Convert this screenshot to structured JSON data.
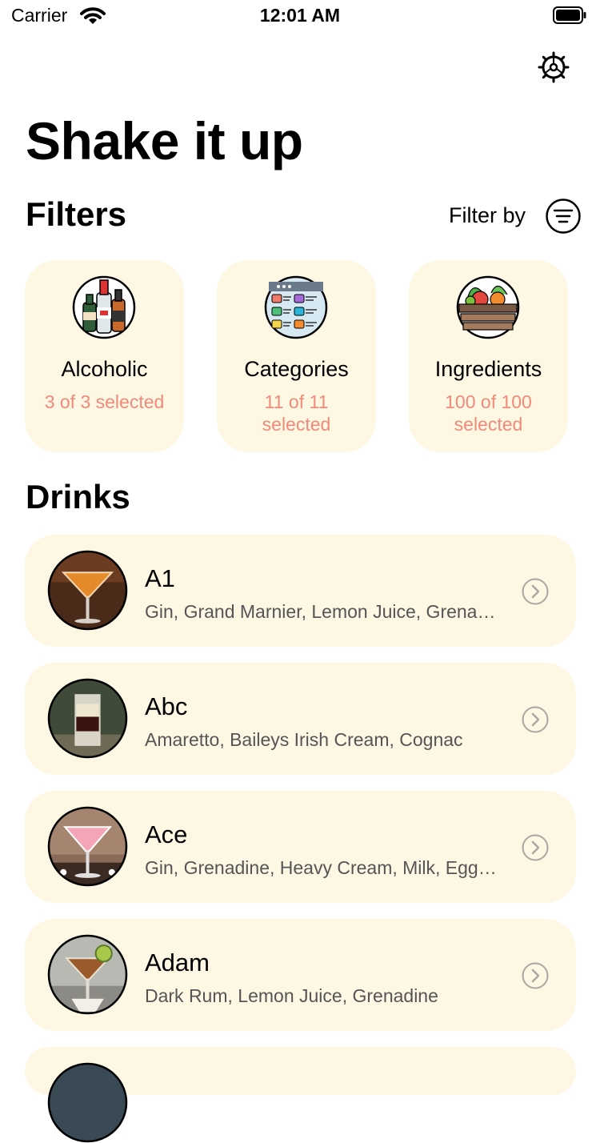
{
  "status_bar": {
    "carrier": "Carrier",
    "time": "12:01 AM"
  },
  "title": "Shake it up",
  "filters": {
    "title": "Filters",
    "filter_by_label": "Filter by",
    "cards": [
      {
        "label": "Alcoholic",
        "count": "3 of 3 selected",
        "icon": "bottles-icon"
      },
      {
        "label": "Categories",
        "count": "11 of 11 selected",
        "icon": "categories-icon"
      },
      {
        "label": "Ingredients",
        "count": "100 of 100 selected",
        "icon": "vegetable-crate-icon"
      }
    ]
  },
  "drinks": {
    "title": "Drinks",
    "items": [
      {
        "name": "A1",
        "ingredients": "Gin, Grand Marnier, Lemon Juice, Grenadine"
      },
      {
        "name": "Abc",
        "ingredients": "Amaretto, Baileys Irish Cream, Cognac"
      },
      {
        "name": "Ace",
        "ingredients": "Gin, Grenadine, Heavy Cream, Milk, Egg White"
      },
      {
        "name": "Adam",
        "ingredients": "Dark Rum, Lemon Juice, Grenadine"
      }
    ]
  },
  "colors": {
    "card_bg": "#fdf7e3",
    "accent_count": "#f08a7a"
  }
}
